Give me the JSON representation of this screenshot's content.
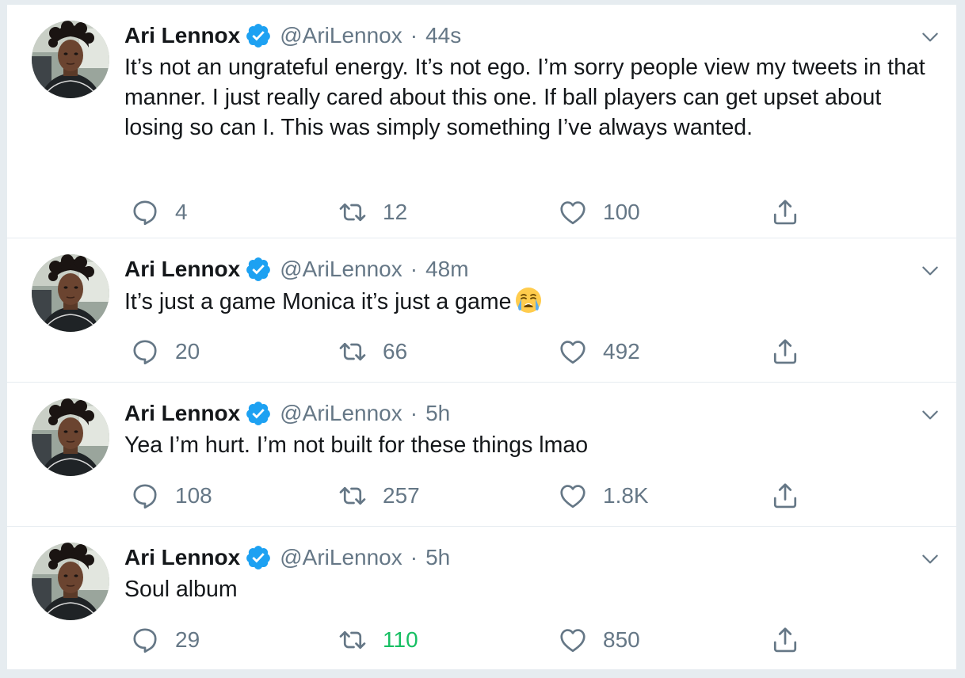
{
  "colors": {
    "text": "#14171a",
    "secondary": "#657786",
    "verified": "#1da1f2",
    "retweeted": "#17bf63",
    "divider": "#e6ecf0"
  },
  "tweets": [
    {
      "name": "Ari Lennox",
      "handle": "@AriLennox",
      "separator": "·",
      "time": "44s",
      "text": "It’s not an ungrateful energy. It’s not ego. I’m sorry people view my tweets in that manner. I just really cared about this one. If ball players can get upset about losing so can I. This was simply something I’ve always wanted.",
      "replies": "4",
      "retweets": "12",
      "likes": "100",
      "retweeted": false
    },
    {
      "name": "Ari Lennox",
      "handle": "@AriLennox",
      "separator": "·",
      "time": "48m",
      "text": "It’s just a game Monica it’s just a game",
      "emoji": "loudly-crying-face-icon",
      "replies": "20",
      "retweets": "66",
      "likes": "492",
      "retweeted": false
    },
    {
      "name": "Ari Lennox",
      "handle": "@AriLennox",
      "separator": "·",
      "time": "5h",
      "text": "Yea I’m hurt. I’m not built for these things lmao",
      "replies": "108",
      "retweets": "257",
      "likes": "1.8K",
      "retweeted": false
    },
    {
      "name": "Ari Lennox",
      "handle": "@AriLennox",
      "separator": "·",
      "time": "5h",
      "text": "Soul album",
      "replies": "29",
      "retweets": "110",
      "likes": "850",
      "retweeted": true
    }
  ]
}
